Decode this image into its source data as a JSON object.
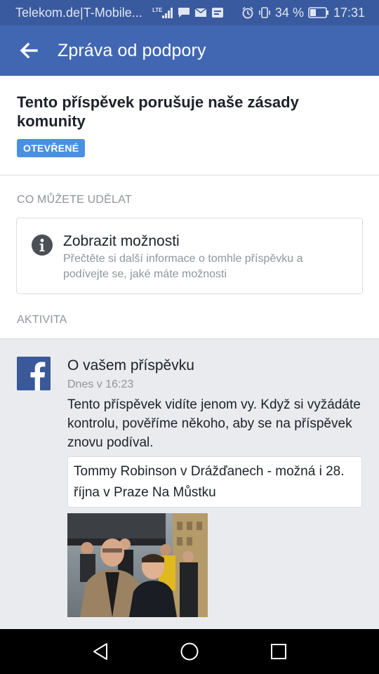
{
  "status_bar": {
    "carrier": "Telekom.de|T-Mobile...",
    "network": "LTE",
    "battery": "34 %",
    "time": "17:31",
    "background": "#3a5a9f"
  },
  "app_bar": {
    "title": "Zpráva od podpory",
    "back_icon": "arrow-left-icon",
    "background": "#4267b2"
  },
  "header": {
    "title": "Tento příspěvek porušuje naše zásady komunity",
    "status_badge": "OTEVŘENÉ",
    "badge_color": "#4a90e2"
  },
  "actions_section": {
    "label": "CO MŮŽETE UDĚLAT",
    "options_card": {
      "icon": "info-icon",
      "title": "Zobrazit možnosti",
      "description": "Přečtěte si další informace o tomhle příspěvku a podívejte se, jaké máte možnosti"
    }
  },
  "activity_section": {
    "label": "AKTIVITA",
    "item": {
      "icon": "facebook-logo-icon",
      "title": "O vašem příspěvku",
      "time": "Dnes v 16:23",
      "message": "Tento příspěvek vidíte jenom vy. Když si vyžádáte kontrolu, pověříme někoho, aby se na příspěvek znovu podíval.",
      "quoted_post": "Tommy Robinson v Drážďanech - možná i 28. října v Praze Na Můstku"
    }
  },
  "nav_bar": {
    "buttons": [
      "back-triangle-icon",
      "home-circle-icon",
      "recents-square-icon"
    ]
  }
}
